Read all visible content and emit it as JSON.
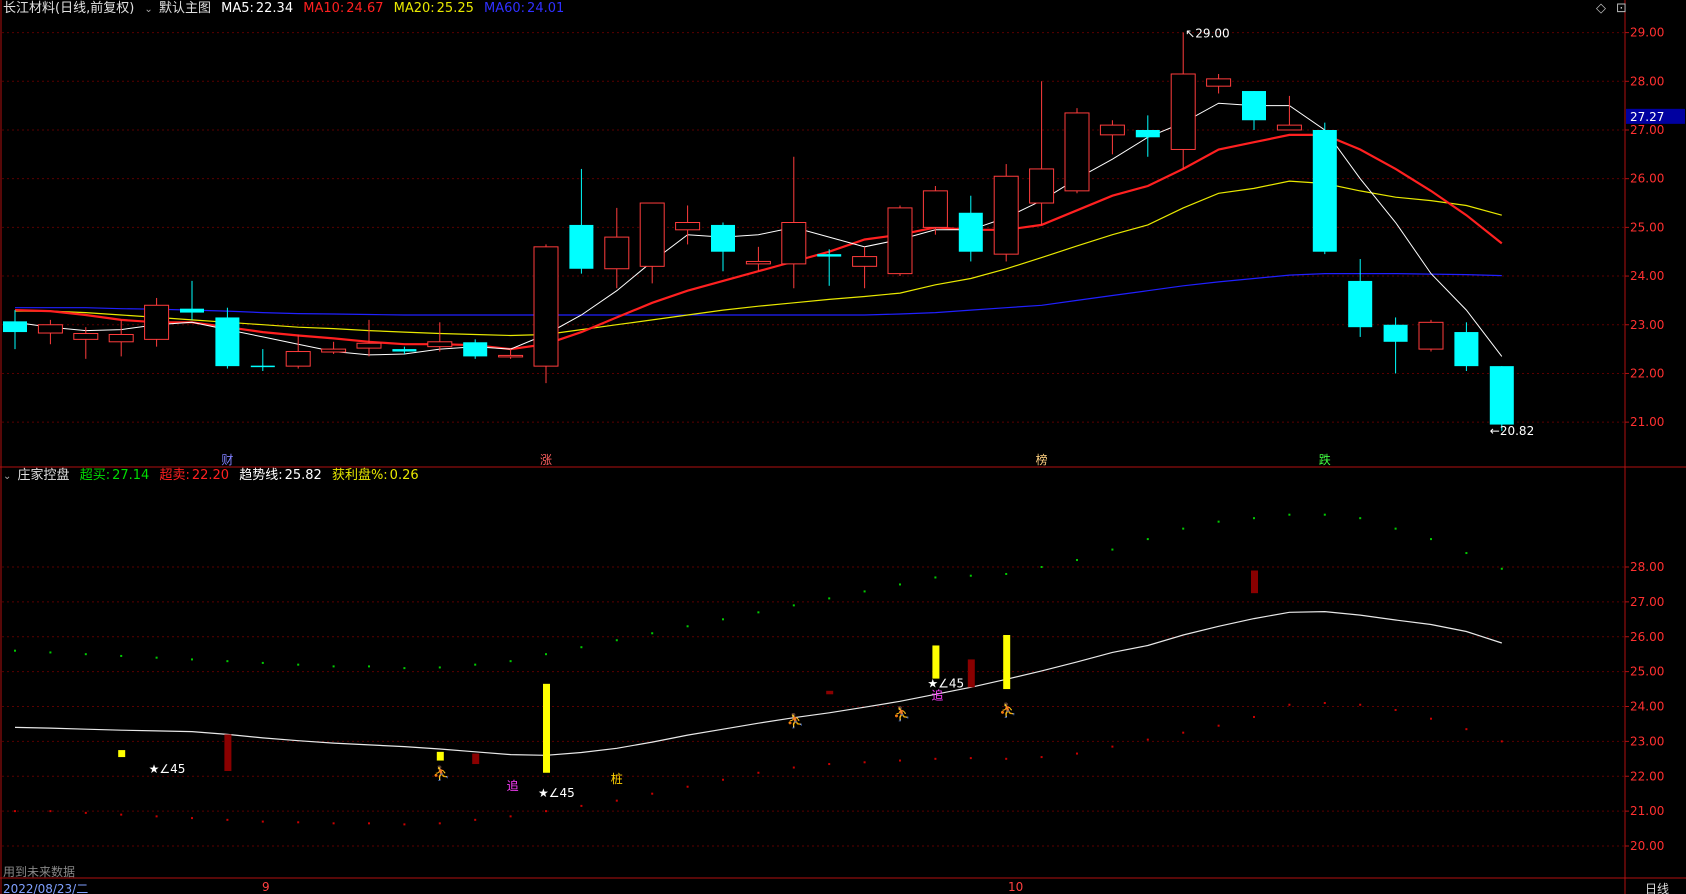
{
  "header": {
    "stock_title": "长江材料(日线,前复权)",
    "main_chart_label": "默认主图",
    "ma5_label": "MA5:",
    "ma5_value": "22.34",
    "ma10_label": "MA10:",
    "ma10_value": "24.67",
    "ma20_label": "MA20:",
    "ma20_value": "25.25",
    "ma60_label": "MA60:",
    "ma60_value": "24.01",
    "colors": {
      "ma5": "#ffffff",
      "ma10": "#ff2020",
      "ma20": "#e8e800",
      "ma60": "#2020ff"
    }
  },
  "sub_header": {
    "indicator_name": "庄家控盘",
    "buy_label": "超买:",
    "buy_value": "27.14",
    "sell_label": "超卖:",
    "sell_value": "22.20",
    "trend_label": "趋势线:",
    "trend_value": "25.82",
    "profit_label": "获利盘%:",
    "profit_value": "0.26"
  },
  "window_controls": {
    "diamond_icon": "◇",
    "restore_icon": "⊡"
  },
  "price_axis": {
    "labels": [
      "29.00",
      "28.00",
      "27.00",
      "26.00",
      "25.00",
      "24.00",
      "23.00",
      "22.00",
      "21.00"
    ],
    "current_price": "27.27"
  },
  "sub_axis": {
    "labels": [
      "28.00",
      "27.00",
      "26.00",
      "25.00",
      "24.00",
      "23.00",
      "22.00",
      "21.00",
      "20.00"
    ]
  },
  "annotations": {
    "high_label": "29.00",
    "low_label": "20.82",
    "event_labels": [
      "财",
      "涨",
      "榜",
      "跌"
    ],
    "angle_label": "∠45",
    "chase_label": "追",
    "pile_label": "桩"
  },
  "footer": {
    "future_data_note": "用到未来数据",
    "date": "2022/08/23/二",
    "month_9": "9",
    "month_10": "10",
    "period": "日线"
  },
  "chart_data": {
    "type": "candlestick",
    "ylim": [
      20.5,
      29.3
    ],
    "candles": [
      [
        23.07,
        22.85,
        23.3,
        22.5
      ],
      [
        22.83,
        23.0,
        23.1,
        22.6
      ],
      [
        22.7,
        22.82,
        22.95,
        22.3
      ],
      [
        22.65,
        22.8,
        23.1,
        22.35
      ],
      [
        22.7,
        23.4,
        23.55,
        22.55
      ],
      [
        23.33,
        23.25,
        23.9,
        23.1
      ],
      [
        23.15,
        22.15,
        23.35,
        22.1
      ],
      [
        22.16,
        22.14,
        22.5,
        22.05
      ],
      [
        22.15,
        22.45,
        22.8,
        22.1
      ],
      [
        22.44,
        22.5,
        22.65,
        22.4
      ],
      [
        22.52,
        22.62,
        23.1,
        22.35
      ],
      [
        22.5,
        22.45,
        22.55,
        22.4
      ],
      [
        22.55,
        22.65,
        23.05,
        22.45
      ],
      [
        22.64,
        22.35,
        22.7,
        22.3
      ],
      [
        22.35,
        22.37,
        22.5,
        22.3
      ],
      [
        22.15,
        24.6,
        24.65,
        21.8
      ],
      [
        25.05,
        24.15,
        26.2,
        24.05
      ],
      [
        24.15,
        24.8,
        25.4,
        23.75
      ],
      [
        24.2,
        25.5,
        25.5,
        23.85
      ],
      [
        24.95,
        25.1,
        25.45,
        24.65
      ],
      [
        25.05,
        24.5,
        25.1,
        24.1
      ],
      [
        24.25,
        24.3,
        24.6,
        24.1
      ],
      [
        24.25,
        25.1,
        26.45,
        23.75
      ],
      [
        24.45,
        24.4,
        24.55,
        23.8
      ],
      [
        24.2,
        24.4,
        24.6,
        23.75
      ],
      [
        24.05,
        25.4,
        25.45,
        24.0
      ],
      [
        25.0,
        25.75,
        25.85,
        24.85
      ],
      [
        25.3,
        24.5,
        25.65,
        24.3
      ],
      [
        24.45,
        26.05,
        26.3,
        24.3
      ],
      [
        25.5,
        26.2,
        28.0,
        25.05
      ],
      [
        25.75,
        27.35,
        27.45,
        25.7
      ],
      [
        26.9,
        27.1,
        27.2,
        26.5
      ],
      [
        27.0,
        26.85,
        27.3,
        26.45
      ],
      [
        26.6,
        28.15,
        29.0,
        26.2
      ],
      [
        27.9,
        28.05,
        28.15,
        27.75
      ],
      [
        27.8,
        27.2,
        27.8,
        27.0
      ],
      [
        27.0,
        27.1,
        27.7,
        27.0
      ],
      [
        27.0,
        24.5,
        27.15,
        24.45
      ],
      [
        23.9,
        22.95,
        24.35,
        22.75
      ],
      [
        23.0,
        22.65,
        23.15,
        22.0
      ],
      [
        22.5,
        23.05,
        23.1,
        22.45
      ],
      [
        22.85,
        22.15,
        23.05,
        22.05
      ],
      [
        22.15,
        20.95,
        22.15,
        20.82
      ]
    ],
    "series": [
      {
        "name": "MA5",
        "values": [
          23.05,
          22.95,
          22.88,
          22.9,
          23.0,
          23.05,
          22.9,
          22.75,
          22.6,
          22.45,
          22.38,
          22.4,
          22.5,
          22.55,
          22.5,
          22.8,
          23.2,
          23.7,
          24.3,
          24.85,
          24.8,
          24.85,
          25.0,
          24.8,
          24.6,
          24.75,
          24.95,
          24.95,
          25.2,
          25.55,
          26.0,
          26.4,
          26.85,
          27.15,
          27.55,
          27.5,
          27.5,
          27.0,
          26.0,
          25.1,
          24.05,
          23.3,
          22.35
        ]
      },
      {
        "name": "MA10",
        "values": [
          23.3,
          23.28,
          23.2,
          23.1,
          23.05,
          23.05,
          22.95,
          22.85,
          22.78,
          22.72,
          22.65,
          22.6,
          22.6,
          22.58,
          22.5,
          22.6,
          22.85,
          23.15,
          23.45,
          23.7,
          23.9,
          24.1,
          24.3,
          24.5,
          24.75,
          24.85,
          25.0,
          24.95,
          24.95,
          25.05,
          25.35,
          25.65,
          25.85,
          26.2,
          26.6,
          26.75,
          26.9,
          26.9,
          26.6,
          26.2,
          25.75,
          25.25,
          24.67
        ]
      },
      {
        "name": "MA20",
        "values": [
          23.28,
          23.28,
          23.25,
          23.2,
          23.15,
          23.1,
          23.05,
          23.0,
          22.95,
          22.92,
          22.88,
          22.85,
          22.82,
          22.8,
          22.78,
          22.8,
          22.9,
          23.0,
          23.1,
          23.2,
          23.3,
          23.38,
          23.45,
          23.52,
          23.58,
          23.65,
          23.82,
          23.95,
          24.15,
          24.38,
          24.62,
          24.85,
          25.05,
          25.4,
          25.7,
          25.8,
          25.95,
          25.9,
          25.75,
          25.62,
          25.55,
          25.45,
          25.25
        ]
      },
      {
        "name": "MA60",
        "values": [
          23.35,
          23.35,
          23.35,
          23.33,
          23.32,
          23.3,
          23.28,
          23.25,
          23.23,
          23.22,
          23.21,
          23.2,
          23.2,
          23.2,
          23.2,
          23.2,
          23.2,
          23.2,
          23.2,
          23.2,
          23.2,
          23.2,
          23.2,
          23.2,
          23.2,
          23.22,
          23.25,
          23.3,
          23.35,
          23.4,
          23.5,
          23.6,
          23.7,
          23.8,
          23.88,
          23.95,
          24.02,
          24.05,
          24.05,
          24.05,
          24.04,
          24.03,
          24.01
        ]
      }
    ],
    "sub_chart": {
      "ylim": [
        19.5,
        29.7
      ],
      "trend_line": [
        23.4,
        23.38,
        23.35,
        23.32,
        23.3,
        23.28,
        23.2,
        23.1,
        23.02,
        22.95,
        22.9,
        22.85,
        22.78,
        22.7,
        22.62,
        22.6,
        22.68,
        22.8,
        22.98,
        23.18,
        23.35,
        23.52,
        23.68,
        23.82,
        23.98,
        24.15,
        24.35,
        24.55,
        24.78,
        25.02,
        25.28,
        25.55,
        25.75,
        26.05,
        26.3,
        26.52,
        26.7,
        26.72,
        26.62,
        26.48,
        26.35,
        26.15,
        25.82
      ],
      "green_dots": [
        25.6,
        25.55,
        25.5,
        25.45,
        25.4,
        25.35,
        25.3,
        25.25,
        25.2,
        25.15,
        25.15,
        25.1,
        25.12,
        25.2,
        25.3,
        25.5,
        25.7,
        25.9,
        26.1,
        26.3,
        26.5,
        26.7,
        26.9,
        27.1,
        27.3,
        27.5,
        27.7,
        27.75,
        27.8,
        28.0,
        28.2,
        28.5,
        28.8,
        29.1,
        29.3,
        29.4,
        29.5,
        29.5,
        29.4,
        29.1,
        28.8,
        28.4,
        27.95
      ],
      "red_dots": [
        21.0,
        21.0,
        20.95,
        20.9,
        20.85,
        20.8,
        20.75,
        20.7,
        20.68,
        20.65,
        20.65,
        20.62,
        20.65,
        20.75,
        20.85,
        21.0,
        21.15,
        21.3,
        21.5,
        21.7,
        21.9,
        22.1,
        22.25,
        22.35,
        22.4,
        22.45,
        22.5,
        22.52,
        22.5,
        22.55,
        22.65,
        22.85,
        23.05,
        23.25,
        23.45,
        23.7,
        24.05,
        24.1,
        24.05,
        23.9,
        23.65,
        23.35,
        23.0
      ],
      "yellow_bars": [
        [
          3,
          22.55,
          22.75
        ],
        [
          12,
          22.45,
          22.7
        ],
        [
          15,
          22.1,
          24.65
        ],
        [
          26,
          24.8,
          25.75
        ],
        [
          28,
          24.5,
          26.05
        ]
      ],
      "red_bars": [
        [
          6,
          22.15,
          23.2
        ],
        [
          13,
          22.35,
          22.65
        ],
        [
          23,
          24.35,
          24.45
        ],
        [
          27,
          24.55,
          25.35
        ],
        [
          35,
          27.25,
          27.9
        ]
      ],
      "runner_marks": [
        [
          12,
          21.95
        ],
        [
          22,
          23.45
        ],
        [
          25,
          23.65
        ],
        [
          28,
          23.75
        ]
      ],
      "star_marks": [
        [
          4,
          22.1
        ],
        [
          15,
          21.4
        ],
        [
          26,
          24.55
        ]
      ]
    }
  }
}
